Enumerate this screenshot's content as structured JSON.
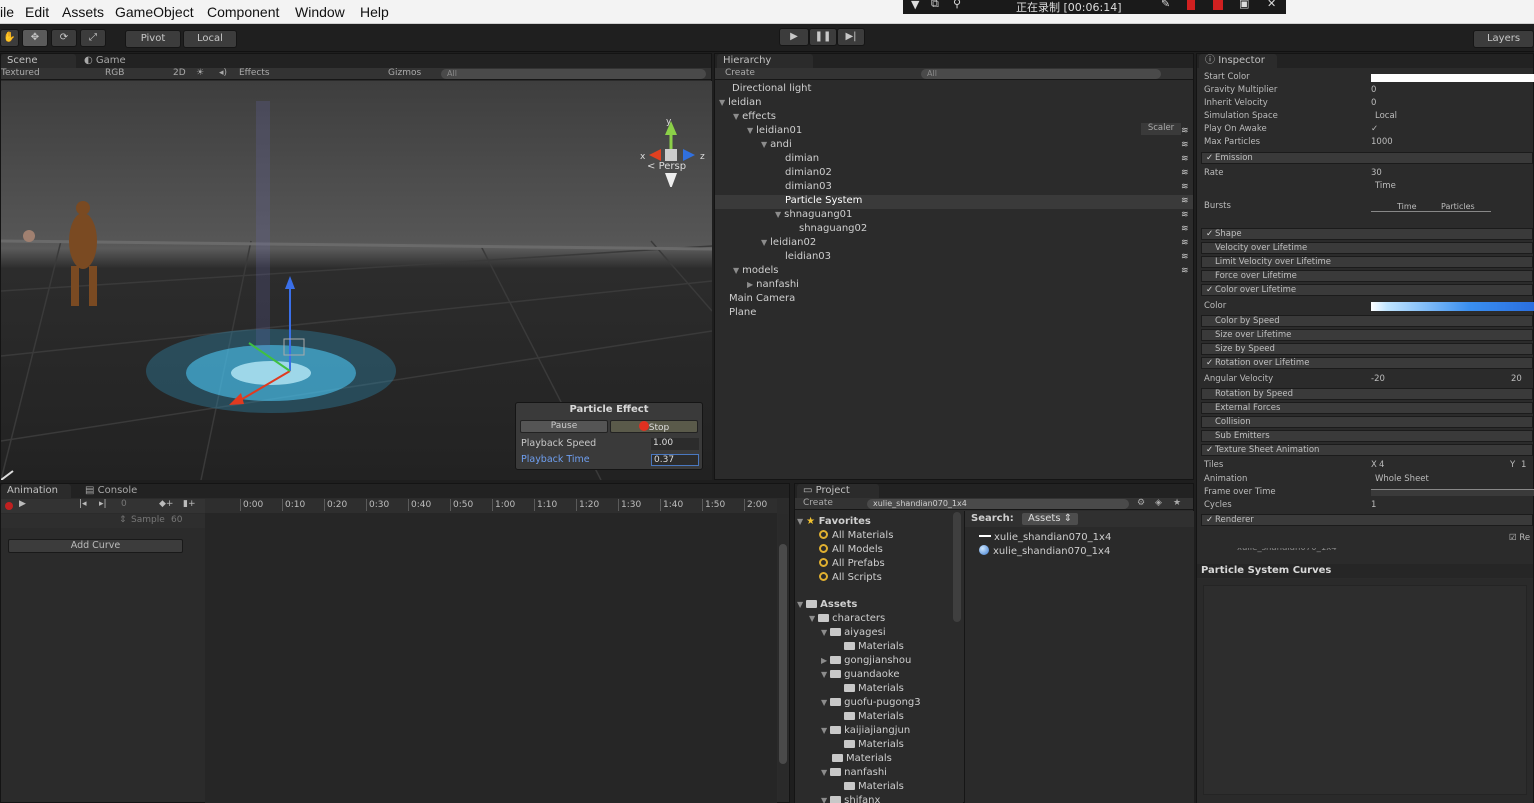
{
  "menubar": {
    "items": [
      "ile",
      "Edit",
      "Assets",
      "GameObject",
      "Component",
      "Window",
      "Help"
    ]
  },
  "recording": {
    "text": "正在录制 [00:06:14]"
  },
  "toolbar": {
    "pivot": "Pivot",
    "local": "Local",
    "layers": "Layers"
  },
  "scene": {
    "tab_scene": "Scene",
    "tab_game": "Game",
    "shading": "Textured",
    "render": "RGB",
    "mode2d": "2D",
    "effects": "Effects",
    "gizmos": "Gizmos",
    "search_placeholder": "All",
    "persp": "Persp",
    "axes": {
      "y": "y",
      "x": "x",
      "z": "z"
    }
  },
  "particle_effect": {
    "title": "Particle Effect",
    "pause": "Pause",
    "stop": "Stop",
    "playback_speed_label": "Playback Speed",
    "playback_speed": "1.00",
    "playback_time_label": "Playback Time",
    "playback_time": "0.37"
  },
  "hierarchy": {
    "tab": "Hierarchy",
    "create": "Create",
    "search_placeholder": "All",
    "scaler": "Scaler",
    "items": [
      {
        "label": "Directional light",
        "arrow": ""
      },
      {
        "label": "leidian",
        "arrow": "▼"
      },
      {
        "label": "effects",
        "arrow": "▼"
      },
      {
        "label": "leidian01",
        "arrow": "▼"
      },
      {
        "label": "andi",
        "arrow": "▼"
      },
      {
        "label": "dimian",
        "arrow": ""
      },
      {
        "label": "dimian02",
        "arrow": ""
      },
      {
        "label": "dimian03",
        "arrow": ""
      },
      {
        "label": "Particle System",
        "arrow": ""
      },
      {
        "label": "shnaguang01",
        "arrow": "▼"
      },
      {
        "label": "shnaguang02",
        "arrow": ""
      },
      {
        "label": "leidian02",
        "arrow": "▼"
      },
      {
        "label": "leidian03",
        "arrow": ""
      },
      {
        "label": "models",
        "arrow": "▼"
      },
      {
        "label": "nanfashi",
        "arrow": "▶"
      },
      {
        "label": "Main Camera",
        "arrow": ""
      },
      {
        "label": "Plane",
        "arrow": ""
      }
    ]
  },
  "inspector": {
    "tab": "Inspector",
    "fields": [
      {
        "label": "Start Color",
        "value": ""
      },
      {
        "label": "Gravity Multiplier",
        "value": "0"
      },
      {
        "label": "Inherit Velocity",
        "value": "0"
      },
      {
        "label": "Simulation Space",
        "value": "Local"
      },
      {
        "label": "Play On Awake",
        "value": "✓"
      },
      {
        "label": "Max Particles",
        "value": "1000"
      }
    ],
    "emission": "Emission",
    "rate_label": "Rate",
    "rate_value": "30",
    "rate_mode": "Time",
    "bursts_label": "Bursts",
    "bursts_time": "Time",
    "bursts_particles": "Particles",
    "modules_a": [
      {
        "label": "Shape",
        "checked": "✓"
      },
      {
        "label": "Velocity over Lifetime",
        "checked": ""
      },
      {
        "label": "Limit Velocity over Lifetime",
        "checked": ""
      },
      {
        "label": "Force over Lifetime",
        "checked": ""
      },
      {
        "label": "Color over Lifetime",
        "checked": "✓"
      }
    ],
    "color_label": "Color",
    "modules_b": [
      {
        "label": "Color by Speed",
        "checked": ""
      },
      {
        "label": "Size over Lifetime",
        "checked": ""
      },
      {
        "label": "Size by Speed",
        "checked": ""
      },
      {
        "label": "Rotation over Lifetime",
        "checked": "✓"
      }
    ],
    "angular_label": "Angular Velocity",
    "angular_min": "-20",
    "angular_max": "20",
    "modules_c": [
      {
        "label": "Rotation by Speed",
        "checked": ""
      },
      {
        "label": "External Forces",
        "checked": ""
      },
      {
        "label": "Collision",
        "checked": ""
      },
      {
        "label": "Sub Emitters",
        "checked": ""
      },
      {
        "label": "Texture Sheet Animation",
        "checked": "✓"
      }
    ],
    "tiles_label": "Tiles",
    "tiles_x_label": "X",
    "tiles_x": "4",
    "tiles_y_label": "Y",
    "tiles_y": "1",
    "animation_label": "Animation",
    "animation_value": "Whole Sheet",
    "frame_label": "Frame over Time",
    "cycles_label": "Cycles",
    "cycles_value": "1",
    "renderer": "Renderer",
    "renderer_right": "Re",
    "curves_title": "Particle System Curves",
    "cut_text": "xulie_shandian070_1x4"
  },
  "animation": {
    "tab": "Animation",
    "console_tab": "Console",
    "sample_label": "Sample",
    "sample_value": "60",
    "frame": "0",
    "add_curve": "Add Curve",
    "ticks": [
      "0:00",
      "0:10",
      "0:20",
      "0:30",
      "0:40",
      "0:50",
      "1:00",
      "1:10",
      "1:20",
      "1:30",
      "1:40",
      "1:50",
      "2:00"
    ]
  },
  "project": {
    "tab": "Project",
    "create": "Create",
    "search_value": "xulie_shandian070_1x4",
    "favorites": "Favorites",
    "fav_items": [
      "All Materials",
      "All Models",
      "All Prefabs",
      "All Scripts"
    ],
    "assets": "Assets",
    "tree": [
      {
        "label": "characters",
        "arrow": "▼",
        "indent": 1
      },
      {
        "label": "aiyagesi",
        "arrow": "▼",
        "indent": 2
      },
      {
        "label": "Materials",
        "arrow": "",
        "indent": 3
      },
      {
        "label": "gongjianshou",
        "arrow": "▶",
        "indent": 2
      },
      {
        "label": "guandaoke",
        "arrow": "▼",
        "indent": 2
      },
      {
        "label": "Materials",
        "arrow": "",
        "indent": 3
      },
      {
        "label": "guofu-pugong3",
        "arrow": "▼",
        "indent": 2
      },
      {
        "label": "Materials",
        "arrow": "",
        "indent": 3
      },
      {
        "label": "kaijiajiangjun",
        "arrow": "▼",
        "indent": 2
      },
      {
        "label": "Materials",
        "arrow": "",
        "indent": 3
      },
      {
        "label": "Materials",
        "arrow": "",
        "indent": 2
      },
      {
        "label": "nanfashi",
        "arrow": "▼",
        "indent": 2
      },
      {
        "label": "Materials",
        "arrow": "",
        "indent": 3
      },
      {
        "label": "shifanx",
        "arrow": "▼",
        "indent": 2
      }
    ],
    "search_label": "Search:",
    "search_scope": "Assets",
    "results": [
      "xulie_shandian070_1x4",
      "xulie_shandian070_1x4"
    ]
  }
}
